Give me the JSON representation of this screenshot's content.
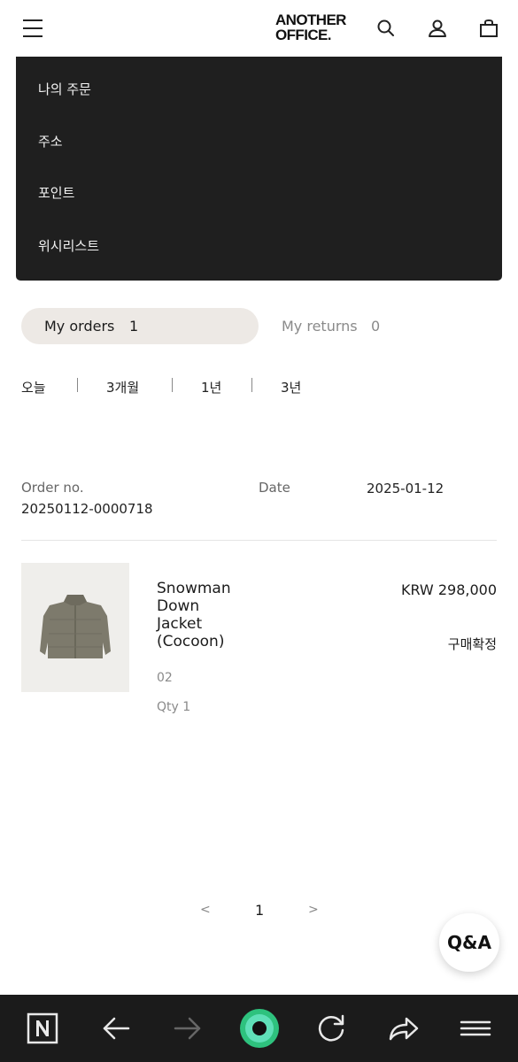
{
  "header": {
    "logo_line1": "ANOTHER",
    "logo_line2": "OFFICE."
  },
  "menu": {
    "items": [
      "나의 주문",
      "주소",
      "포인트",
      "위시리스트"
    ]
  },
  "tabs": {
    "orders_label": "My orders",
    "orders_count": "1",
    "returns_label": "My returns",
    "returns_count": "0"
  },
  "periods": [
    "오늘",
    "3개월",
    "1년",
    "3년"
  ],
  "order": {
    "number_label": "Order no.",
    "number": "20250112-0000718",
    "date_label": "Date",
    "date": "2025-01-12"
  },
  "item": {
    "name_lines": [
      "Snowman",
      "Down",
      "Jacket",
      "(Cocoon)"
    ],
    "price": "KRW 298,000",
    "status": "구매확정",
    "option": "02",
    "qty": "Qty 1"
  },
  "pagination": {
    "prev": "<",
    "current": "1",
    "next": ">"
  },
  "qa_button": "Q&A",
  "colors": {
    "menu_bg": "#1f1f1f",
    "tab_active_bg": "#ede9e5",
    "browser_bar_bg": "#1b1b1b",
    "browser_accent": "#2ec27e"
  },
  "icons": {
    "header": [
      "menu-icon",
      "search-icon",
      "user-icon",
      "bag-icon"
    ],
    "browser": [
      "naver-home-icon",
      "back-icon",
      "forward-icon",
      "green-home-icon",
      "reload-icon",
      "share-icon",
      "browser-menu-icon"
    ]
  }
}
